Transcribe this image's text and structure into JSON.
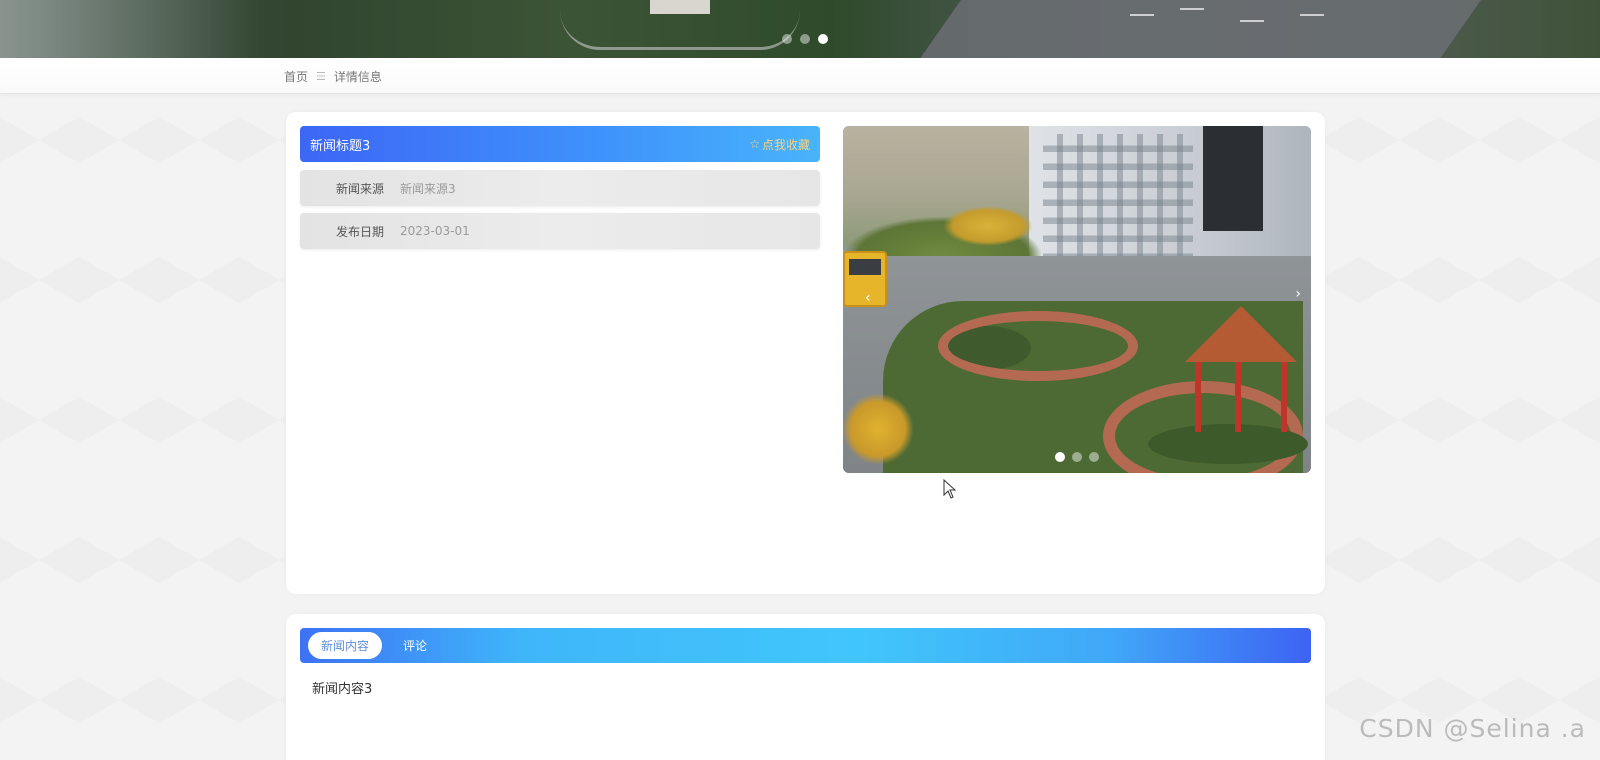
{
  "banner": {
    "slides": 3,
    "active_slide": 3
  },
  "breadcrumb": {
    "home": "首页",
    "separator": "☰",
    "current": "详情信息"
  },
  "detail": {
    "title": "新闻标题3",
    "favorite_label": "点我收藏",
    "favorite_icon": "star-outline-icon",
    "fields": [
      {
        "label": "新闻来源",
        "value": "新闻来源3"
      },
      {
        "label": "发布日期",
        "value": "2023-03-01"
      }
    ]
  },
  "carousel": {
    "prev_icon": "‹",
    "next_icon": "›",
    "slides": 3,
    "active_slide": 1
  },
  "content": {
    "tabs": [
      {
        "label": "新闻内容",
        "active": true
      },
      {
        "label": "评论",
        "active": false
      }
    ],
    "body": "新闻内容3"
  },
  "watermark": "CSDN @Selina .a",
  "colors": {
    "title_gradient_start": "#3d66f5",
    "title_gradient_end": "#48b4fb",
    "favorite": "#ffd27a",
    "tab_active_text": "#5e8fdc"
  }
}
